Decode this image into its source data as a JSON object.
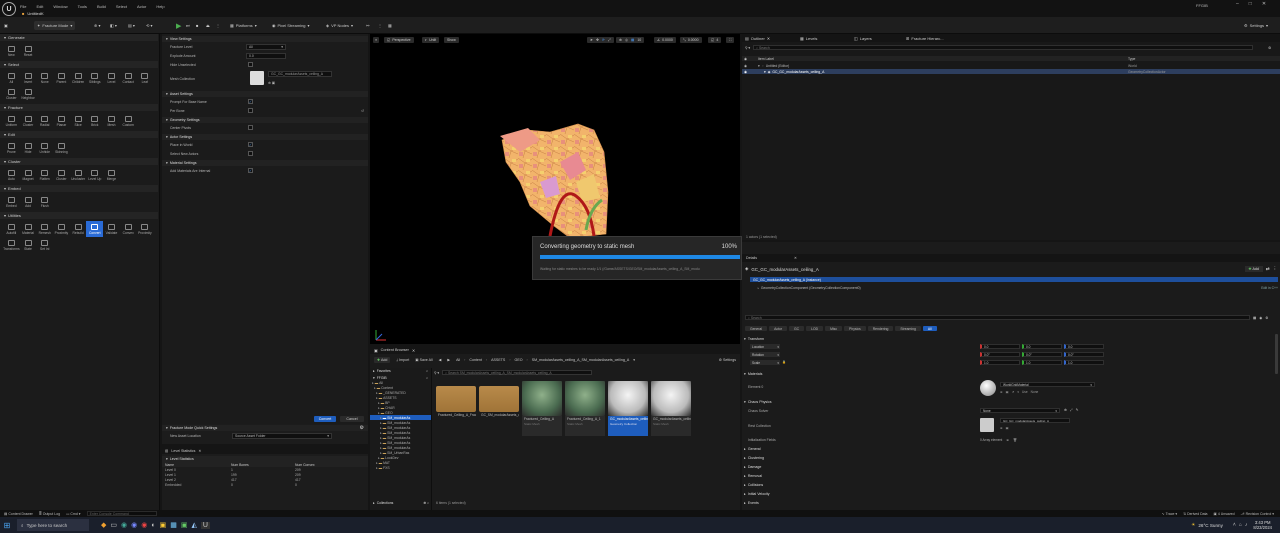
{
  "app": {
    "logo": "U",
    "menu": [
      "File",
      "Edit",
      "Window",
      "Tools",
      "Build",
      "Select",
      "Actor",
      "Help"
    ],
    "tab": "UntitledK",
    "project": "FFGIB"
  },
  "toolbar": {
    "mode": "Fracture Mode",
    "platforms": "Platforms",
    "pixel_streaming": "Pixel Streaming",
    "vp_nodes": "VP Nodes",
    "settings": "Settings"
  },
  "palette": {
    "sections": [
      {
        "name": "Generate",
        "tools": [
          "New",
          "Reset"
        ]
      },
      {
        "name": "Select",
        "tools": [
          "All",
          "Invert",
          "None",
          "Parent",
          "Children",
          "Siblings",
          "Level",
          "Contact",
          "Leaf",
          "Cluster",
          "Neighbor"
        ]
      },
      {
        "name": "Fracture",
        "tools": [
          "Uniform",
          "Cluster",
          "Radial",
          "Planar",
          "Slice",
          "Brick",
          "Mesh",
          "Custom"
        ]
      },
      {
        "name": "Edit",
        "tools": [
          "Prune",
          "Hide",
          "Unhide",
          "Skinning"
        ]
      },
      {
        "name": "Cluster",
        "tools": [
          "Auto",
          "Magnet",
          "Flatten",
          "Cluster",
          "Uncluster",
          "Level Up",
          "Merge"
        ]
      },
      {
        "name": "Embed",
        "tools": [
          "Embed",
          "Add",
          "Flush"
        ]
      },
      {
        "name": "Utilities",
        "tools": [
          "Autofill",
          "Material",
          "Remesh",
          "Proximity",
          "Rebuild",
          "Convert",
          "Validate",
          "Convex",
          "Proximity",
          "Transforms",
          "State",
          "Set Ini"
        ]
      }
    ],
    "selected_tool": "Convert"
  },
  "settings": {
    "groups": [
      {
        "title": "View Settings",
        "rows": [
          {
            "label": "Fracture Level",
            "value": "All"
          },
          {
            "label": "Explode Amount",
            "value": "0.0"
          },
          {
            "label": "Hide Unselected",
            "check": false
          },
          {
            "label": "Mesh Collection",
            "value": "GC_GC_modularAssets_ceiling_A"
          }
        ]
      },
      {
        "title": "Asset Settings",
        "rows": [
          {
            "label": "Prompt For Base Name",
            "check": true
          },
          {
            "label": "Per Bone",
            "check": false
          }
        ]
      },
      {
        "title": "Geometry Settings",
        "rows": [
          {
            "label": "Center Pivots",
            "check": false
          }
        ]
      },
      {
        "title": "Actor Settings",
        "rows": [
          {
            "label": "Place in World",
            "check": true
          },
          {
            "label": "Select New Actors",
            "check": false
          }
        ]
      },
      {
        "title": "Material Settings",
        "rows": [
          {
            "label": "Add Materials Are Internal",
            "check": true
          }
        ]
      }
    ],
    "convert": "Convert",
    "cancel": "Cancel",
    "quick_title": "Fracture Mode Quick Settings",
    "new_asset_label": "New Asset Location",
    "new_asset_value": "Source Asset Folder"
  },
  "level_stats": {
    "tab": "Level Statistics",
    "header": "Level Statistics",
    "columns": [
      "Name",
      "Num Bones",
      "Num Convex"
    ],
    "rows": [
      [
        "Level 0",
        "1",
        "209"
      ],
      [
        "Level 1",
        "199",
        "209"
      ],
      [
        "Level 2",
        "417",
        "417"
      ],
      [
        "Embedded",
        "0",
        "0"
      ]
    ]
  },
  "viewport": {
    "perspective": "Perspective",
    "lit": "Unlit",
    "show": "Show",
    "snap": "10",
    "angle": "0.0000",
    "scale": "0.25",
    "speed": "4"
  },
  "progress": {
    "title": "Converting geometry to static mesh",
    "percent": "100%",
    "fraction": 1.0,
    "detail": "Waiting for static meshes to be ready 1/1 (/Game/ASSETS/GEO/SM_modularAssets_ceiling_A_SM_modu"
  },
  "content_browser": {
    "tab": "Content Browser",
    "add": "Add",
    "import": "Import",
    "save_all": "Save All",
    "path": [
      "All",
      "Content",
      "ASSETS",
      "GEO",
      "SM_modularAssets_ceiling_A_SM_modularAssets_ceiling_A"
    ],
    "settings": "Settings",
    "favorites": "Favorites",
    "root": "FFGIB",
    "search": "Search SM_modularAssets_ceiling_A_SM_modularAssets_ceiling_A",
    "folders": [
      {
        "name": "All",
        "sel": false
      },
      {
        "name": "Content",
        "sel": false
      },
      {
        "name": "_GENERATED",
        "sel": false
      },
      {
        "name": "ASSETS",
        "sel": false
      },
      {
        "name": "BP",
        "sel": false
      },
      {
        "name": "CHAR",
        "sel": false
      },
      {
        "name": "GEO",
        "sel": false
      },
      {
        "name": "SM_modularAs",
        "sel": true
      },
      {
        "name": "SM_modularAs",
        "sel": false
      },
      {
        "name": "SM_modularAs",
        "sel": false
      },
      {
        "name": "SM_modularAs",
        "sel": false
      },
      {
        "name": "SM_modularAs",
        "sel": false
      },
      {
        "name": "SM_modularAs",
        "sel": false
      },
      {
        "name": "SM_modularAs",
        "sel": false
      },
      {
        "name": "SM_UrbanRas",
        "sel": false
      },
      {
        "name": "LookDev",
        "sel": false
      },
      {
        "name": "MAT",
        "sel": false
      },
      {
        "name": "FXS",
        "sel": false
      }
    ],
    "collections": "Collections",
    "count": "6 items (1 selected)",
    "assets": [
      {
        "name": "Fractured_Ceiling_A_Fractured_Ceiling_A",
        "type": "",
        "kind": "folder"
      },
      {
        "name": "GC_SM_modularAssets_ceiling_A_GC_modularAssets_",
        "type": "",
        "kind": "folder"
      },
      {
        "name": "Fractured_Ceiling_A",
        "type": "Static Mesh",
        "kind": "green"
      },
      {
        "name": "Fractured_Ceiling_A_1",
        "type": "Static Mesh",
        "kind": "green"
      },
      {
        "name": "GC_modularAssets_ceiling_A",
        "type": "Geometry Collection",
        "kind": "white",
        "sel": true
      },
      {
        "name": "GC_modularAssets_ceiling_A_SM",
        "type": "Static Mesh",
        "kind": "white"
      }
    ]
  },
  "outliner": {
    "tabs": [
      "Outliner",
      "Levels",
      "Layers",
      "Fracture Hierarc..."
    ],
    "search": "Search",
    "col_label": "Item Label",
    "col_type": "Type",
    "rows": [
      {
        "label": "Untitled (Editor)",
        "type": "World",
        "indent": 1,
        "sel": false
      },
      {
        "label": "GC_GC_modularAssets_ceiling_A",
        "type": "GeometryCollectionActor",
        "indent": 2,
        "sel": true
      }
    ],
    "count": "1 actors (1 selected)"
  },
  "details": {
    "tab": "Details",
    "title": "GC_GC_modularAssets_ceiling_A",
    "add": "Add",
    "instance": "GC_GC_modularAssets_ceiling_A (Instance)",
    "component": "GeometryCollectionComponent (GeometryCollectionComponent0)",
    "edit_in_cpp": "Edit in C++",
    "search": "Search",
    "filters": [
      "General",
      "Actor",
      "GC",
      "LOD",
      "Misc",
      "Physics",
      "Rendering",
      "Streaming",
      "All"
    ],
    "transform": "Transform",
    "location": {
      "label": "Location",
      "x": "0.0",
      "y": "0.0",
      "z": "0.0"
    },
    "rotation": {
      "label": "Rotation",
      "x": "0.0°",
      "y": "0.0°",
      "z": "0.0°"
    },
    "scale": {
      "label": "Scale",
      "x": "1.0",
      "y": "1.0",
      "z": "1.0"
    },
    "materials": "Materials",
    "element0": "Element 0",
    "material_value": "WorldGridMaterial",
    "material_use": "Use",
    "material_none": "None",
    "chaos": "Chaos Physics",
    "chaos_solver": "Chaos Solver",
    "chaos_solver_value": "None",
    "rest_collection": "Rest Collection",
    "rest_collection_value": "GC_GC_modularAssets_ceiling_A",
    "init_fields": "Initialization Fields",
    "init_fields_value": "0 Array element",
    "sections": [
      "General",
      "Clustering",
      "Damage",
      "Removal",
      "Collisions",
      "Initial Velocity",
      "Events"
    ]
  },
  "statusbar": {
    "content_drawer": "Content Drawer",
    "output_log": "Output Log",
    "cmd": "Cmd",
    "console_placeholder": "Enter Console Command",
    "trace": "Trace",
    "derived": "Derived Data",
    "unsaved": "4 Unsaved",
    "revision": "Revision Control"
  },
  "taskbar": {
    "search": "Type here to search",
    "weather": "26°C  Sunny",
    "time": "3:43 PM",
    "date": "8/23/2024"
  }
}
